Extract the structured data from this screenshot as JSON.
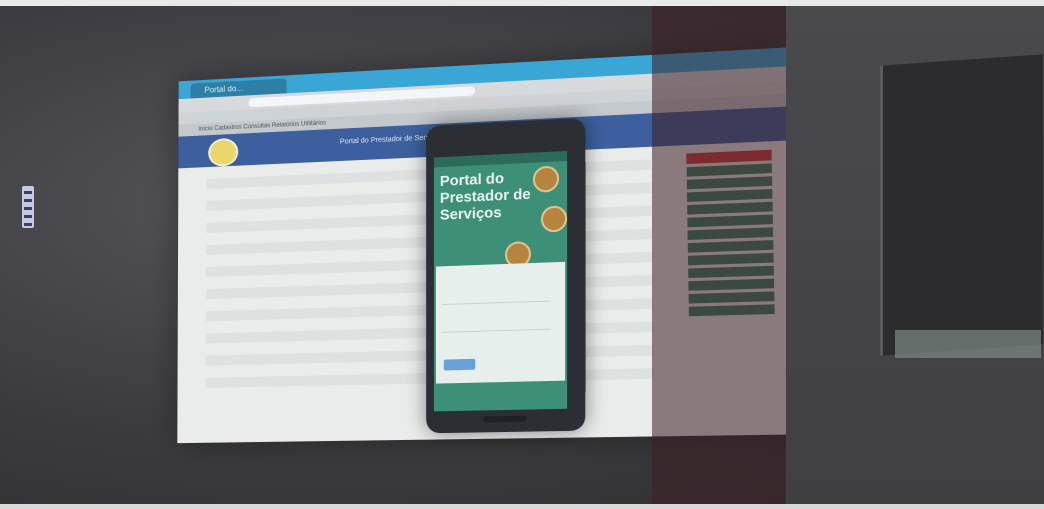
{
  "browser": {
    "tab_title": "Portal do...",
    "url": "",
    "menu_items": "Início   Cadastros   Consultas   Relatórios   Utilitários"
  },
  "site": {
    "header_text": "Portal do Prestador de Serviços"
  },
  "sidebar_menu": {
    "heading": "",
    "items": [
      "",
      "",
      "",
      "",
      "",
      "",
      "",
      "",
      "",
      "",
      "",
      ""
    ]
  },
  "phone": {
    "title": "Portal do Prestador de Serviços",
    "subtitle": "",
    "link": "",
    "login_title": "",
    "login_button": ""
  },
  "colors": {
    "brand_blue": "#3d5f9e",
    "phone_green": "#3e8f78",
    "menu_red": "#c43c3a",
    "menu_green": "#3c7f66"
  }
}
